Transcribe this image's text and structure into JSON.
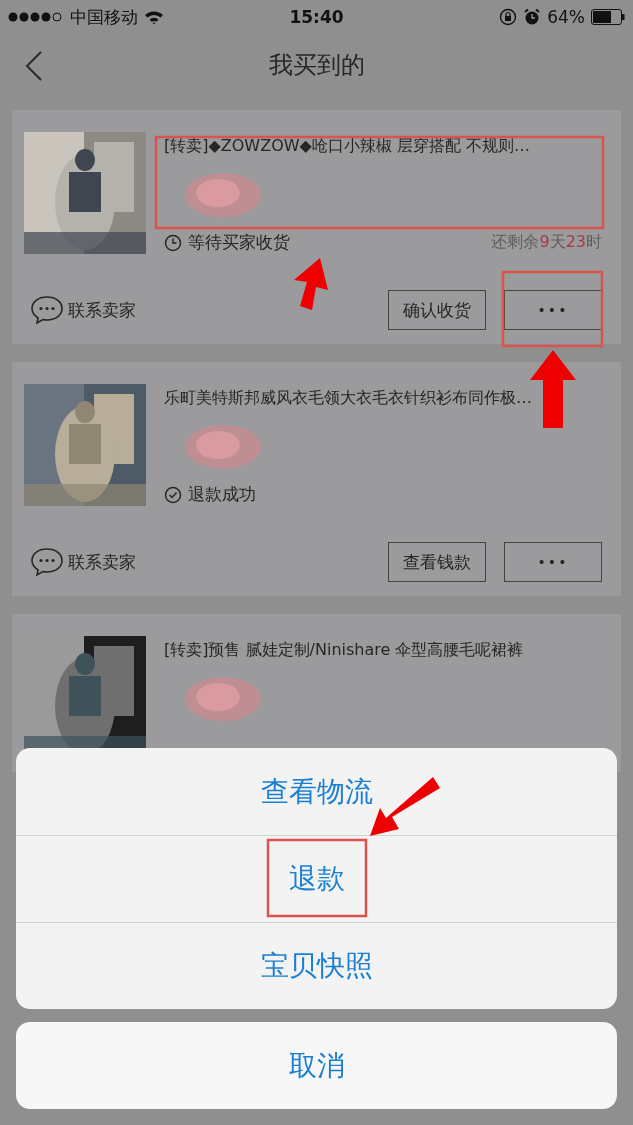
{
  "status_bar": {
    "carrier": "中国移动",
    "time": "15:40",
    "battery": "64%"
  },
  "nav": {
    "title": "我买到的"
  },
  "orders": [
    {
      "title": "[转卖]◆ZOWZOW◆呛口小辣椒 层穿搭配 不规则…",
      "kind": "waiting",
      "status": "等待买家收货",
      "remaining": {
        "prefix": "还剩余",
        "days": "9",
        "day_unit": "天",
        "hours": "23",
        "hour_unit": "时"
      },
      "contact": "联系卖家",
      "action": "确认收货",
      "more": "•••"
    },
    {
      "title": "乐町美特斯邦威风衣毛领大衣毛衣针织衫布同作极…",
      "kind": "done",
      "status": "退款成功",
      "contact": "联系卖家",
      "action": "查看钱款",
      "more": "•••"
    },
    {
      "title": "[转卖]预售 腻娃定制/Ninishare 伞型高腰毛呢裙裤"
    }
  ],
  "action_sheet": {
    "options": [
      "查看物流",
      "退款",
      "宝贝快照"
    ],
    "cancel": "取消"
  }
}
